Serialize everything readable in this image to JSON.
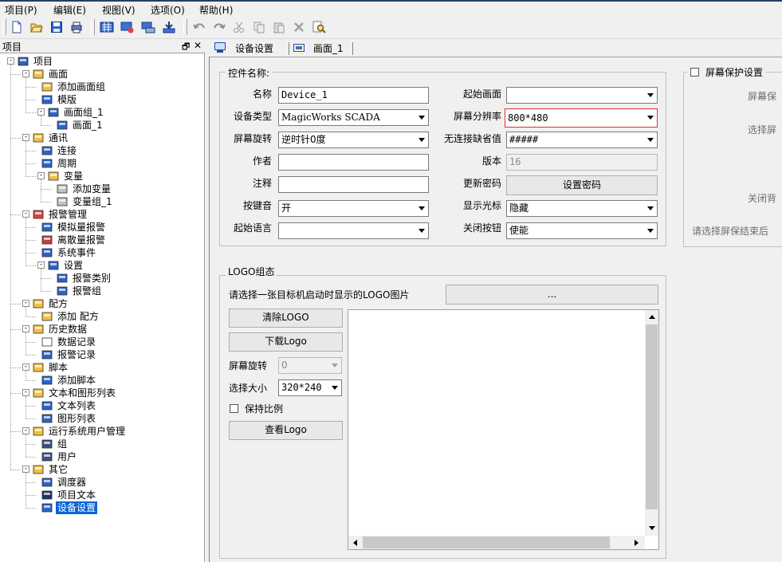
{
  "menu": [
    {
      "label": "项目(P)"
    },
    {
      "label": "编辑(E)"
    },
    {
      "label": "视图(V)"
    },
    {
      "label": "选项(O)"
    },
    {
      "label": "帮助(H)"
    }
  ],
  "toolbar_icons": [
    "new-icon",
    "open-icon",
    "save-icon",
    "print-icon",
    "compile-icon",
    "simulate-icon",
    "download-icon",
    "upload-icon",
    "undo-icon",
    "redo-icon",
    "cut-icon",
    "copy-icon",
    "paste-icon",
    "delete-icon",
    "find-icon"
  ],
  "left_pane": {
    "title": "项目",
    "pin_glyph": "🗗",
    "close_glyph": "✕",
    "tree": [
      {
        "label": "项目",
        "depth": 0,
        "icon": "factory-icon",
        "exp": "-"
      },
      {
        "label": "画面",
        "depth": 1,
        "icon": "folder-screen-icon",
        "exp": "-"
      },
      {
        "label": "添加画面组",
        "depth": 2,
        "icon": "add-screen-group-icon"
      },
      {
        "label": "模版",
        "depth": 2,
        "icon": "template-icon"
      },
      {
        "label": "画面组_1",
        "depth": 2,
        "icon": "screen-group-icon",
        "exp": "-"
      },
      {
        "label": "画面_1",
        "depth": 3,
        "icon": "screen-icon"
      },
      {
        "label": "通讯",
        "depth": 1,
        "icon": "communication-icon",
        "exp": "-"
      },
      {
        "label": "连接",
        "depth": 2,
        "icon": "connection-icon"
      },
      {
        "label": "周期",
        "depth": 2,
        "icon": "cycle-icon"
      },
      {
        "label": "变量",
        "depth": 2,
        "icon": "variable-icon",
        "exp": "-"
      },
      {
        "label": "添加变量",
        "depth": 3,
        "icon": "add-variable-icon"
      },
      {
        "label": "变量组_1",
        "depth": 3,
        "icon": "variable-group-icon"
      },
      {
        "label": "报警管理",
        "depth": 1,
        "icon": "alarm-folder-icon",
        "exp": "-"
      },
      {
        "label": "模拟量报警",
        "depth": 2,
        "icon": "analog-alarm-icon"
      },
      {
        "label": "离散量报警",
        "depth": 2,
        "icon": "discrete-alarm-icon"
      },
      {
        "label": "系统事件",
        "depth": 2,
        "icon": "system-event-icon"
      },
      {
        "label": "设置",
        "depth": 2,
        "icon": "settings-icon",
        "exp": "-"
      },
      {
        "label": "报警类别",
        "depth": 3,
        "icon": "alarm-class-icon"
      },
      {
        "label": "报警组",
        "depth": 3,
        "icon": "alarm-group-icon"
      },
      {
        "label": "配方",
        "depth": 1,
        "icon": "recipe-folder-icon",
        "exp": "-"
      },
      {
        "label": "添加 配方",
        "depth": 2,
        "icon": "add-recipe-icon"
      },
      {
        "label": "历史数据",
        "depth": 1,
        "icon": "history-folder-icon",
        "exp": "-"
      },
      {
        "label": "数据记录",
        "depth": 2,
        "icon": "data-log-icon"
      },
      {
        "label": "报警记录",
        "depth": 2,
        "icon": "alarm-log-icon"
      },
      {
        "label": "脚本",
        "depth": 1,
        "icon": "script-folder-icon",
        "exp": "-"
      },
      {
        "label": "添加脚本",
        "depth": 2,
        "icon": "add-script-icon"
      },
      {
        "label": "文本和图形列表",
        "depth": 1,
        "icon": "list-folder-icon",
        "exp": "-"
      },
      {
        "label": "文本列表",
        "depth": 2,
        "icon": "text-list-icon"
      },
      {
        "label": "图形列表",
        "depth": 2,
        "icon": "graphic-list-icon"
      },
      {
        "label": "运行系统用户管理",
        "depth": 1,
        "icon": "user-admin-icon",
        "exp": "-"
      },
      {
        "label": "组",
        "depth": 2,
        "icon": "group-icon"
      },
      {
        "label": "用户",
        "depth": 2,
        "icon": "user-icon"
      },
      {
        "label": "其它",
        "depth": 1,
        "icon": "other-folder-icon",
        "exp": "-"
      },
      {
        "label": "调度器",
        "depth": 2,
        "icon": "scheduler-icon"
      },
      {
        "label": "项目文本",
        "depth": 2,
        "icon": "project-text-icon"
      },
      {
        "label": "设备设置",
        "depth": 2,
        "icon": "device-settings-icon",
        "selected": true
      }
    ]
  },
  "tabs": [
    {
      "label": "设备设置",
      "active": true
    },
    {
      "label": "画面_1",
      "active": false
    }
  ],
  "control_group": {
    "title": "控件名称:",
    "name_label": "名称",
    "name_value": "Device_1",
    "device_type_label": "设备类型",
    "device_type_value": "MagicWorks SCADA",
    "rotation_label": "屏幕旋转",
    "rotation_value": "逆时针0度",
    "author_label": "作者",
    "author_value": "",
    "comment_label": "注释",
    "comment_value": "",
    "key_sound_label": "按键音",
    "key_sound_value": "开",
    "start_language_label": "起始语言",
    "start_language_value": "",
    "start_screen_label": "起始画面",
    "start_screen_value": "",
    "resolution_label": "屏幕分辨率",
    "resolution_value": "800*480",
    "no_conn_default_label": "无连接缺省值",
    "no_conn_default_value": "#####",
    "version_label": "版本",
    "version_value": "16",
    "update_pwd_label": "更新密码",
    "set_pwd_button": "设置密码",
    "show_cursor_label": "显示光标",
    "show_cursor_value": "隐藏",
    "close_button_label": "关闭按钮",
    "close_button_value": "使能"
  },
  "screensaver_group": {
    "title": "屏幕保护设置",
    "line1": "屏幕保",
    "line2": "选择屏",
    "line3": "关闭背",
    "line4": "请选择屏保结束后"
  },
  "logo_group": {
    "title": "LOGO组态",
    "prompt": "请选择一张目标机启动时显示的LOGO图片",
    "browse_button": "...",
    "clear_button": "清除LOGO",
    "download_button": "下载Logo",
    "rotation_label": "屏幕旋转",
    "rotation_value": "0",
    "size_label": "选择大小",
    "size_value": "320*240",
    "keep_ratio_label": "保持比例",
    "view_button": "查看Logo"
  }
}
